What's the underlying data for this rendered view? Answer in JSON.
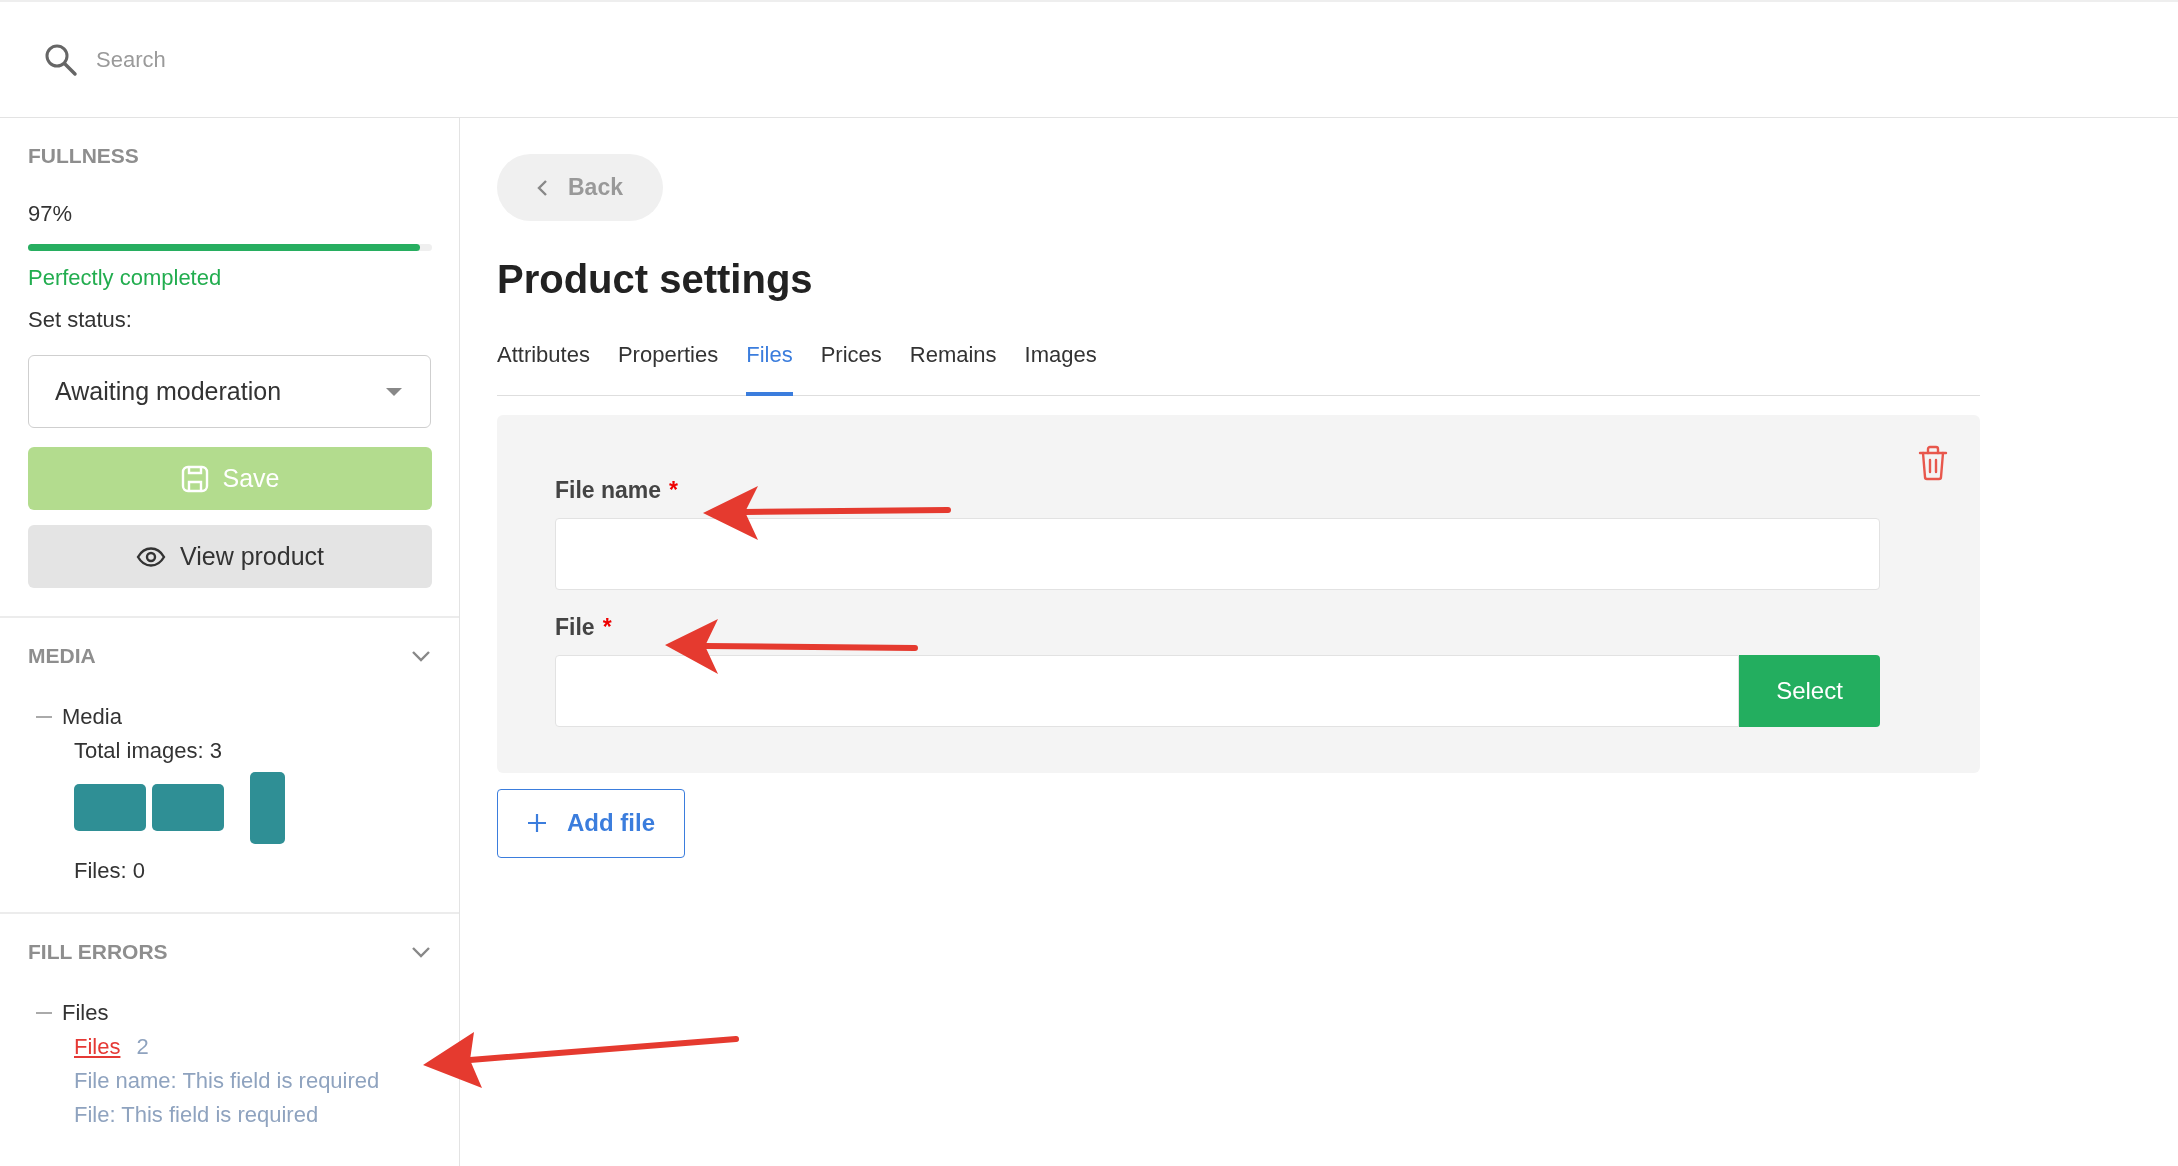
{
  "search": {
    "placeholder": "Search"
  },
  "sidebar": {
    "fullness": {
      "title": "FULLNESS",
      "percent": "97%",
      "level": 0.97,
      "status": "Perfectly completed"
    },
    "status_label": "Set status:",
    "status_select": {
      "value": "Awaiting moderation"
    },
    "buttons": [
      {
        "label": "Save",
        "kind": "save"
      },
      {
        "label": "View product",
        "kind": "view"
      }
    ],
    "media": {
      "title": "MEDIA",
      "tree_item": "Media",
      "total": "Total images: 3",
      "thumbnails": [
        {
          "kind": "landscape"
        },
        {
          "kind": "landscape"
        },
        {
          "kind": "portrait"
        }
      ],
      "files": "Files: 0"
    },
    "fill_errors": {
      "title": "FILL ERRORS",
      "tree_item": "Files",
      "link": "Files",
      "count": "2",
      "errors": [
        "File name: This field is required",
        "File: This field is required"
      ]
    }
  },
  "main": {
    "back": "Back",
    "title": "Product settings",
    "tabs": [
      {
        "label": "Attributes",
        "selected": false
      },
      {
        "label": "Properties",
        "selected": false
      },
      {
        "label": "Files",
        "selected": true
      },
      {
        "label": "Prices",
        "selected": false
      },
      {
        "label": "Remains",
        "selected": false
      },
      {
        "label": "Images",
        "selected": false
      }
    ],
    "fields": [
      {
        "label": "File name",
        "required_mark": "*",
        "kind": "text"
      },
      {
        "label": "File",
        "required_mark": "*",
        "kind": "file",
        "button": "Select"
      }
    ],
    "add_button": "Add file"
  }
}
